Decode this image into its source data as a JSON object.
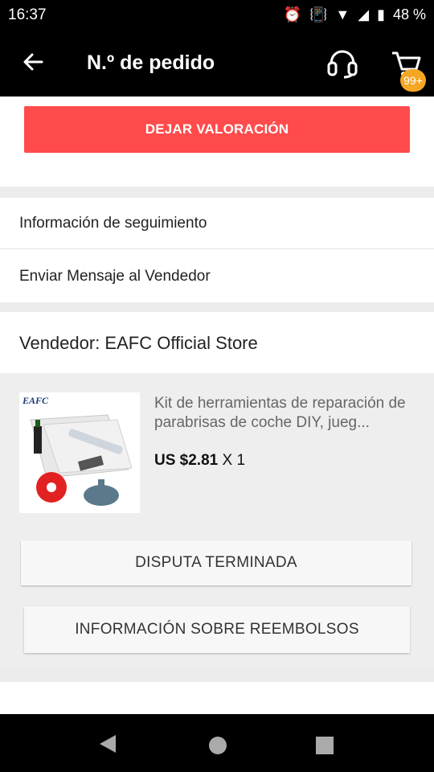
{
  "status_bar": {
    "time": "16:37",
    "battery": "48 %",
    "icons": [
      "alarm-icon",
      "vibrate-icon",
      "wifi-icon",
      "signal-icon",
      "battery-icon"
    ]
  },
  "app_bar": {
    "title": "N.º de pedido",
    "cart_badge": "99+",
    "icons": [
      "back-arrow-icon",
      "headset-icon",
      "cart-icon"
    ]
  },
  "actions": {
    "leave_rating": "DEJAR VALORACIÓN"
  },
  "menu": {
    "items": [
      {
        "label": "Información de seguimiento"
      },
      {
        "label": "Enviar Mensaje al Vendedor"
      }
    ]
  },
  "seller": {
    "label": "Vendedor: EAFC Official Store"
  },
  "product": {
    "name": "Kit de herramientas de reparación de parabrisas de coche DIY, jueg...",
    "price": "US $2.81",
    "quantity": "X 1",
    "brand_text": "EAFC"
  },
  "buttons": {
    "dispute": "DISPUTA TERMINADA",
    "refund_info": "INFORMACIÓN SOBRE REEMBOLSOS"
  },
  "colors": {
    "accent_red": "#ff4b4b",
    "badge_orange": "#f5a623"
  }
}
